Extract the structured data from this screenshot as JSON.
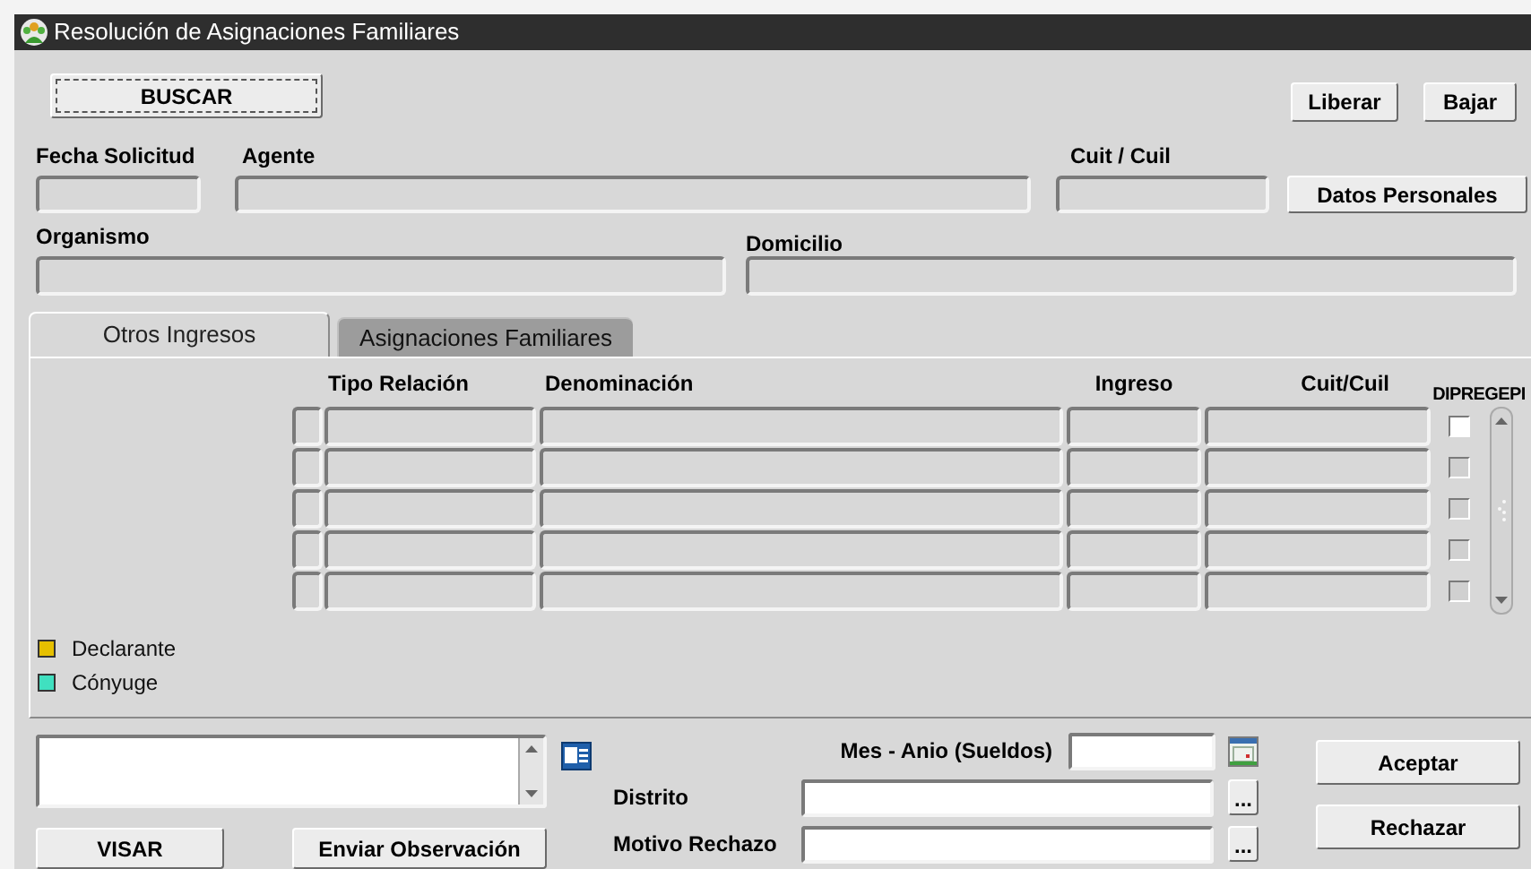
{
  "window": {
    "title": "Resolución de Asignaciones Familiares"
  },
  "top_buttons": {
    "search": "BUSCAR",
    "release": "Liberar",
    "download": "Bajar"
  },
  "header_fields": [
    {
      "label": "Fecha  Solicitud"
    },
    {
      "label": "Agente"
    },
    {
      "label": "Cuit / Cuil"
    }
  ],
  "personal_data_button": "Datos Personales",
  "address_fields": [
    {
      "label": "Organismo"
    },
    {
      "label": "Domicilio"
    }
  ],
  "tabs": [
    {
      "label": "Otros Ingresos",
      "selected": true
    },
    {
      "label": "Asignaciones Familiares",
      "selected": false
    }
  ],
  "table": {
    "columns": [
      "Tipo Relación",
      "Denominación",
      "Ingreso",
      "Cuit/Cuil",
      "DIPREGEPI"
    ],
    "rows": [
      {
        "disabled": false
      },
      {
        "disabled": true
      },
      {
        "disabled": true
      },
      {
        "disabled": true
      },
      {
        "disabled": true
      }
    ]
  },
  "legend": [
    {
      "label": "Declarante",
      "color": "#e6c000"
    },
    {
      "label": "Cónyuge",
      "color": "#40e0c0"
    }
  ],
  "bottom": {
    "period_label": "Mes - Anio (Sueldos)",
    "district_label": "Distrito",
    "reject_reason_label": "Motivo Rechazo",
    "lookup_button": "...",
    "lookup_button_2": "...",
    "approve_button": "VISAR",
    "send_button": "Enviar Observación",
    "accept_button": "Aceptar",
    "reject_button": "Rechazar"
  }
}
